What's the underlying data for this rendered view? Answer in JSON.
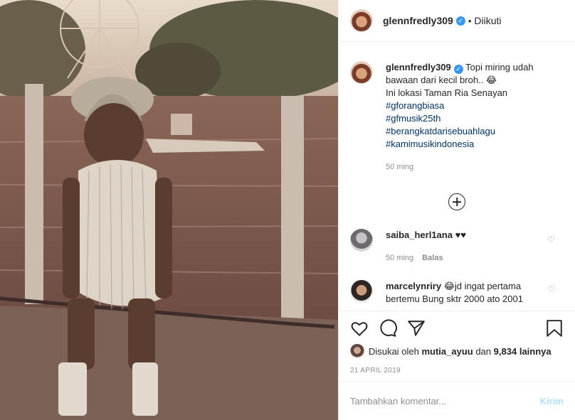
{
  "post": {
    "username": "glennfredly309",
    "follow_status": "Diikuti",
    "caption_text": "Topi miring udah bawaan dari kecil broh.. 😂",
    "caption_line2": "Ini lokasi Taman Ria Senayan",
    "hashtags": [
      "#gforangbiasa",
      "#gfmusik25th",
      "#berangkatdarisebuahlagu",
      "#kamimusikindonesia"
    ],
    "caption_time": "50 ming"
  },
  "comments": [
    {
      "username": "saiba_herl1ana",
      "text": "♥♥",
      "time": "50 ming",
      "reply": "Balas"
    },
    {
      "username": "marcelynriry",
      "text": "😂jd ingat pertama bertemu Bung sktr 2000 ato 2001"
    }
  ],
  "likes": {
    "prefix": "Disukai oleh",
    "user": "mutia_ayuu",
    "middle": "dan",
    "count": "9,834",
    "suffix": "lainnya"
  },
  "date": "21 APRIL 2019",
  "add_comment": {
    "placeholder": "Tambahkan komentar...",
    "send_label": "Kirim"
  },
  "colors": {
    "verified": "#3897f0",
    "hashtag": "#003569",
    "send_disabled": "#b2dffc"
  },
  "icons": [
    "heart-icon",
    "comment-icon",
    "share-icon",
    "bookmark-icon",
    "plus-circle-icon",
    "verified-icon"
  ]
}
